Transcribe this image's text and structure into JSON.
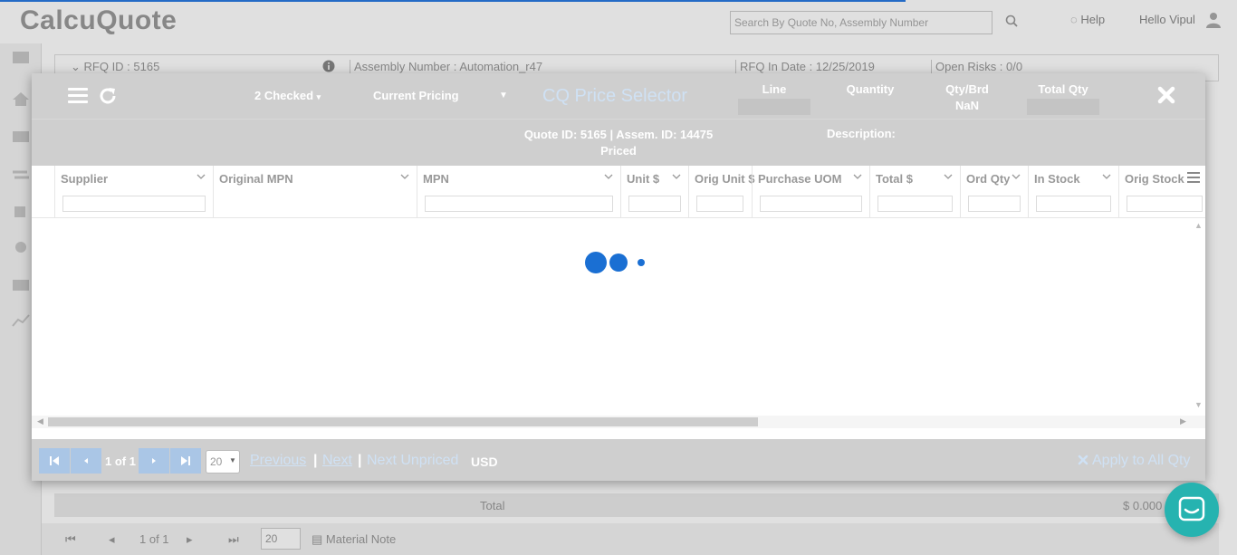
{
  "background": {
    "logo": "CalcuQuote",
    "search_placeholder": "Search By Quote No, Assembly Number",
    "help_label": "Help",
    "greeting": "Hello Vipul",
    "rfq_id": "RFQ ID : 5165",
    "assembly_number": "Assembly Number : Automation_r47",
    "rfq_in_date": "RFQ In Date : 12/25/2019",
    "open_risks": "Open Risks : 0/0",
    "total_label": "Total",
    "total_value": "$ 0.000",
    "pager_text": "1 of 1",
    "page_size": "20",
    "material_note": "Material Note"
  },
  "modal": {
    "checked_label": "2 Checked",
    "pricing_label": "Current Pricing",
    "title": "CQ Price Selector",
    "header_cols": {
      "line": "Line",
      "quantity": "Quantity",
      "qty_brd": "Qty/Brd",
      "qty_brd_value": "NaN",
      "total_qty": "Total Qty"
    },
    "quote_info_line1": "Quote ID: 5165 | Assem. ID: 14475",
    "quote_info_line2": "Priced",
    "description_label": "Description:",
    "columns": [
      {
        "label": "Supplier"
      },
      {
        "label": "Original MPN"
      },
      {
        "label": "MPN"
      },
      {
        "label": "Unit $"
      },
      {
        "label": "Orig Unit $"
      },
      {
        "label": "Purchase UOM"
      },
      {
        "label": "Total $"
      },
      {
        "label": "Ord Qty"
      },
      {
        "label": "In Stock"
      },
      {
        "label": "Orig Stock"
      }
    ],
    "footer": {
      "page_text": "1 of 1",
      "page_size": "20",
      "previous": "Previous",
      "next": "Next",
      "next_unpriced": "Next Unpriced",
      "currency": "USD",
      "apply_all": "Apply to All Qty"
    }
  },
  "colors": {
    "accent": "#1a6fd3",
    "header_bg": "#cfcfcf",
    "link": "#cfe1f4",
    "chat": "#26b3b0"
  }
}
